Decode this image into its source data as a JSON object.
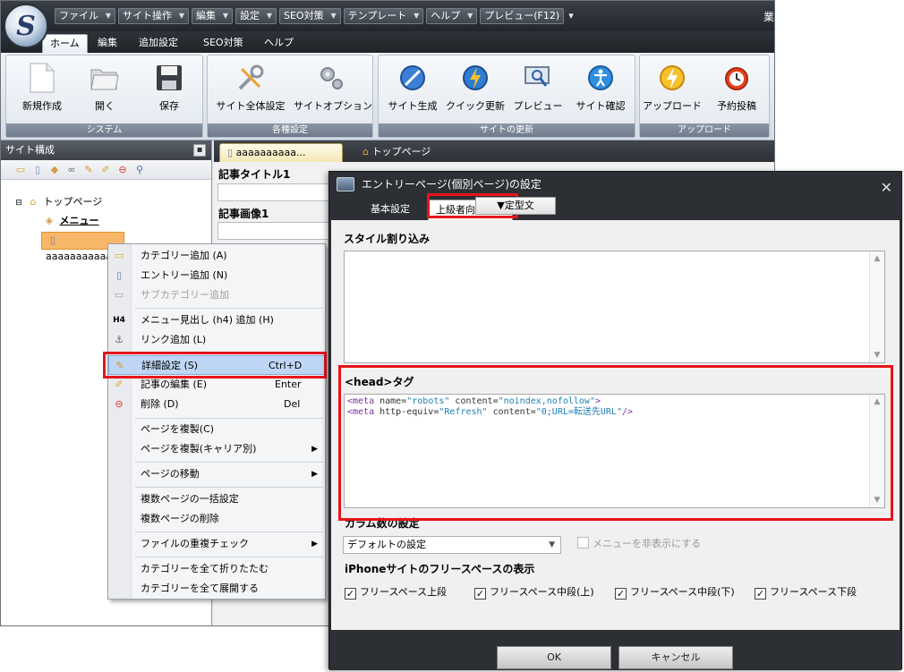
{
  "app": {
    "title_partial": "業",
    "menubar": [
      {
        "label": "ファイル"
      },
      {
        "label": "サイト操作"
      },
      {
        "label": "編集"
      },
      {
        "label": "設定"
      },
      {
        "label": "SEO対策"
      },
      {
        "label": "テンプレート"
      },
      {
        "label": "ヘルプ"
      },
      {
        "label": "プレビュー(F12)"
      }
    ],
    "menubar_more": "▾",
    "ribbon_tabs": [
      "ホーム",
      "編集",
      "追加設定",
      "SEO対策",
      "ヘルプ"
    ],
    "ribbon_groups": [
      {
        "label": "システム",
        "buttons": [
          "新規作成",
          "開く",
          "保存"
        ]
      },
      {
        "label": "各種設定",
        "buttons": [
          "サイト全体設定",
          "サイトオプション"
        ]
      },
      {
        "label": "サイトの更新",
        "buttons": [
          "サイト生成",
          "クイック更新",
          "プレビュー",
          "サイト確認"
        ]
      },
      {
        "label": "アップロード",
        "buttons": [
          "アップロード",
          "予約投稿"
        ]
      }
    ]
  },
  "left_panel": {
    "title": "サイト構成",
    "tree": {
      "root": "トップページ",
      "menu": "メニュー",
      "selected": "aaaaaaaaaaa"
    }
  },
  "editor": {
    "tabs": [
      "aaaaaaaaaa...",
      "トップページ"
    ],
    "fields": [
      "記事タイトル1",
      "記事画像1"
    ]
  },
  "context_menu": {
    "items": [
      {
        "label": "カテゴリー追加 (A)"
      },
      {
        "label": "エントリー追加 (N)"
      },
      {
        "label": "サブカテゴリー追加"
      },
      {
        "label": "メニュー見出し (h4) 追加 (H)"
      },
      {
        "label": "リンク追加 (L)"
      },
      {
        "label": "詳細設定 (S)",
        "shortcut": "Ctrl+D"
      },
      {
        "label": "記事の編集 (E)",
        "shortcut": "Enter"
      },
      {
        "label": "削除 (D)",
        "shortcut": "Del"
      },
      {
        "label": "ページを複製(C)"
      },
      {
        "label": "ページを複製(キャリア別)"
      },
      {
        "label": "ページの移動"
      },
      {
        "label": "複数ページの一括設定"
      },
      {
        "label": "複数ページの削除"
      },
      {
        "label": "ファイルの重複チェック"
      },
      {
        "label": "カテゴリーを全て折りたたむ"
      },
      {
        "label": "カテゴリーを全て展開する"
      }
    ],
    "icon_h4": "H4"
  },
  "dialog": {
    "title": "エントリーページ(個別ページ)の設定",
    "tabs": [
      "基本設定",
      "上級者向け設定"
    ],
    "style_section": "スタイル割り込み",
    "head_section": "<head>タグ",
    "template_button": "▼定型文",
    "head_code": {
      "line1": {
        "open": "<meta ",
        "a1": "name=",
        "v1": "\"robots\"",
        "a2": " content=",
        "v2": "\"noindex,nofollow\"",
        "close": ">"
      },
      "line2": {
        "open": "<meta ",
        "a1": "http-equiv=",
        "v1": "\"Refresh\"",
        "a2": " content=",
        "v2": "\"0;URL=転送先URL\"",
        "close": "/>"
      }
    },
    "column_section": "カラム数の設定",
    "column_select": "デフォルトの設定",
    "hide_menu_checkbox": "メニューを非表示にする",
    "iphone_section": "iPhoneサイトのフリースペースの表示",
    "iphone_checkboxes": [
      "フリースペース上段",
      "フリースペース中段(上)",
      "フリースペース中段(下)",
      "フリースペース下段"
    ],
    "ok": "OK",
    "cancel": "キャンセル"
  },
  "colors": {
    "highlight_red": "#e8131a",
    "selection_orange": "#f8b668",
    "dark_chrome": "#2c2f34"
  }
}
